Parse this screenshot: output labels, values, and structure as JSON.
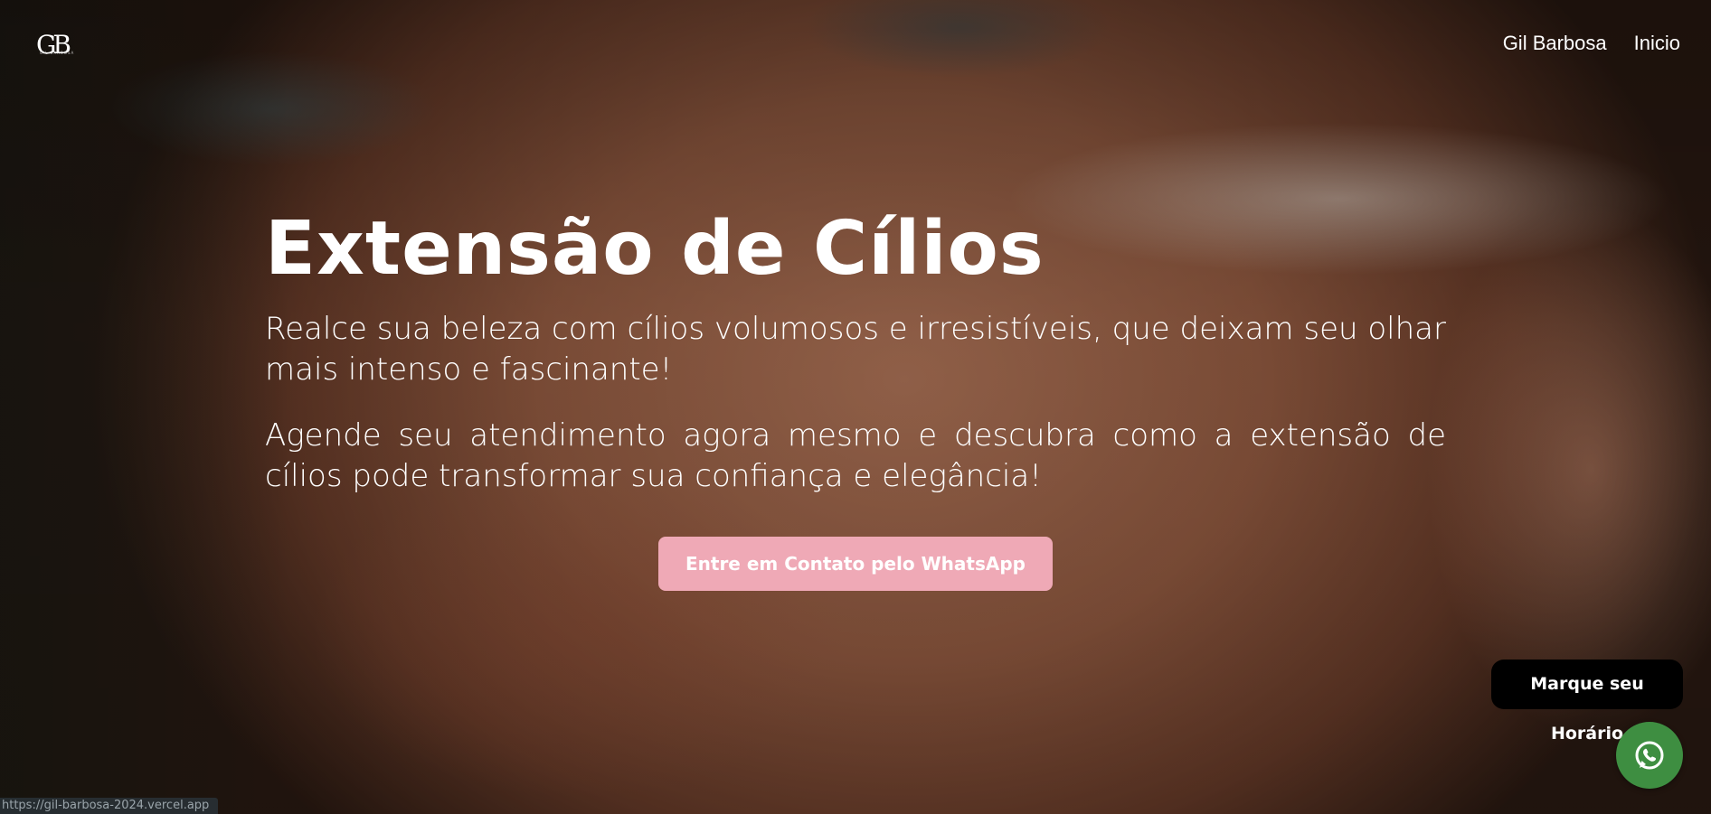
{
  "header": {
    "logo_text": "GB",
    "logo_tagline": "GIL BARBOSA",
    "nav": [
      {
        "label": "Gil Barbosa"
      },
      {
        "label": "Inicio"
      }
    ]
  },
  "hero": {
    "title": "Extensão de Cílios",
    "paragraph_1": "Realce sua beleza com cílios volumosos e irresistíveis, que deixam seu olhar mais intenso e fascinante!",
    "paragraph_2": "Agende seu atendimento agora mesmo e descubra como a extensão de cílios pode transformar sua confiança e elegância!",
    "cta_label": "Entre em Contato pelo WhatsApp"
  },
  "floating": {
    "schedule_label": "Marque seu Horário",
    "whatsapp_icon": "whatsapp-icon"
  },
  "status_bar": {
    "url": "https://gil-barbosa-2024.vercel.app"
  },
  "colors": {
    "cta_bg": "#efa9b6",
    "schedule_bg": "#000000",
    "whatsapp_bg": "#3e8e41"
  }
}
